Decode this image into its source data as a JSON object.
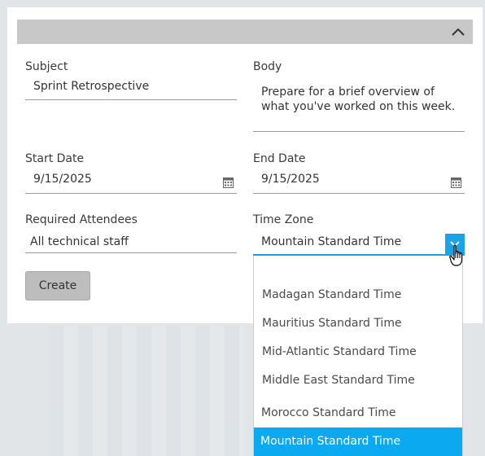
{
  "form": {
    "subject_label": "Subject",
    "subject_value": "Sprint Retrospective",
    "body_label": "Body",
    "body_value": "Prepare for a brief overview of what you've worked on this week.",
    "start_label": "Start Date",
    "start_value": "9/15/2025",
    "end_label": "End Date",
    "end_value": "9/15/2025",
    "attendees_label": "Required Attendees",
    "attendees_value": "All technical staff",
    "timezone_label": "Time Zone",
    "timezone_value": "Mountain Standard Time",
    "create_label": "Create"
  },
  "dropdown": {
    "options": [
      "Madagan Standard Time",
      "Mauritius Standard Time",
      "Mid-Atlantic Standard Time",
      "Middle East Standard Time",
      "Morocco Standard Time",
      "Mountain Standard Time"
    ],
    "selected": "Mountain Standard Time"
  },
  "icons": {
    "collapse": "chevron-up-icon",
    "calendar": "calendar-icon",
    "dropdown": "chevron-down-icon",
    "cursor": "hand-cursor-icon"
  },
  "colors": {
    "accent": "#1aa3e8",
    "selected_bg": "#0ba9ef",
    "header_bar": "#c8c8c8",
    "button_bg": "#bdbdbd"
  }
}
